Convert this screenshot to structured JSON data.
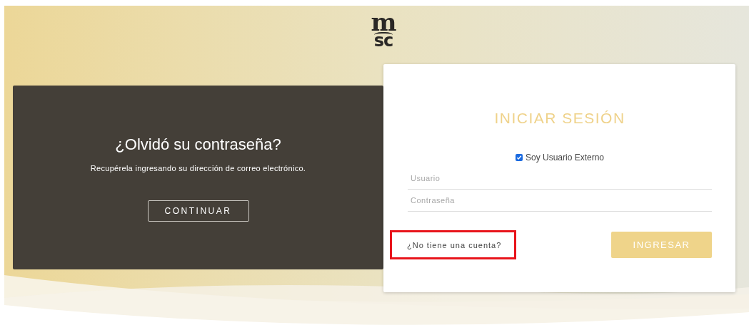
{
  "logo": {
    "top": "m",
    "bottom": "sc"
  },
  "forgot_panel": {
    "title": "¿Olvidó su contraseña?",
    "text": "Recupérela ingresando su dirección de correo electrónico.",
    "button": "CONTINUAR"
  },
  "login": {
    "title": "INICIAR SESIÓN",
    "external_user": {
      "label": "Soy Usuario Externo",
      "checked": true
    },
    "fields": [
      {
        "placeholder": "Usuario"
      },
      {
        "placeholder": "Contraseña"
      }
    ],
    "signup_link": {
      "label": "¿No tiene una cuenta?",
      "highlighted": true
    },
    "button": "INGRESAR"
  }
}
